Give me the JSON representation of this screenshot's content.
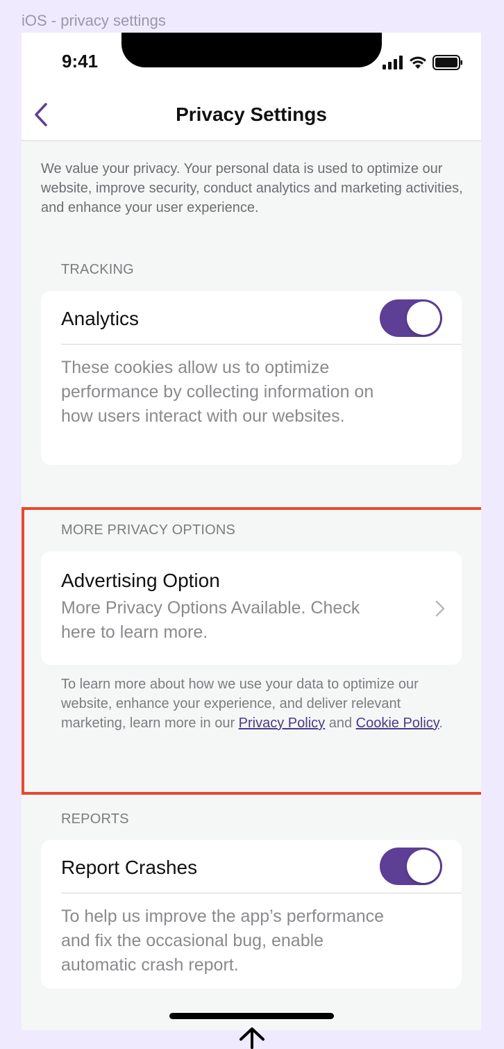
{
  "frame_caption": "iOS - privacy settings",
  "status_bar": {
    "time": "9:41",
    "icons": [
      "cellular-signal-icon",
      "wifi-icon",
      "battery-icon"
    ]
  },
  "nav": {
    "back_icon": "chevron-left-icon",
    "title": "Privacy Settings"
  },
  "intro_text": "We value your privacy. Your personal data is used to optimize our website, improve security, conduct analytics and marketing activities, and enhance your user experience.",
  "sections": {
    "tracking": {
      "header": "TRACKING",
      "analytics": {
        "title": "Analytics",
        "toggle_on": true,
        "description": "These cookies allow us to optimize performance by collecting information on how users interact with our websites."
      }
    },
    "more_privacy": {
      "header": "MORE PRIVACY OPTIONS",
      "advertising": {
        "title": "Advertising Option",
        "subtitle": "More Privacy Options Available. Check here to learn more.",
        "chevron_icon": "chevron-right-icon"
      },
      "footnote": {
        "lead": "To learn more about how we use your data to optimize our website, enhance your experience, and deliver relevant marketing, learn more in our ",
        "privacy_link": "Privacy Policy",
        "and": " and ",
        "cookie_link": "Cookie Policy",
        "end": "."
      }
    },
    "reports": {
      "header": "REPORTS",
      "crashes": {
        "title": "Report Crashes",
        "toggle_on": true,
        "description": "To help us improve the app’s performance and fix the occasional bug, enable automatic crash report."
      }
    }
  },
  "colors": {
    "accent": "#5d3f95",
    "highlight": "#e6492f",
    "canvas": "#efeafd",
    "screen_bg": "#f5f6f6"
  }
}
